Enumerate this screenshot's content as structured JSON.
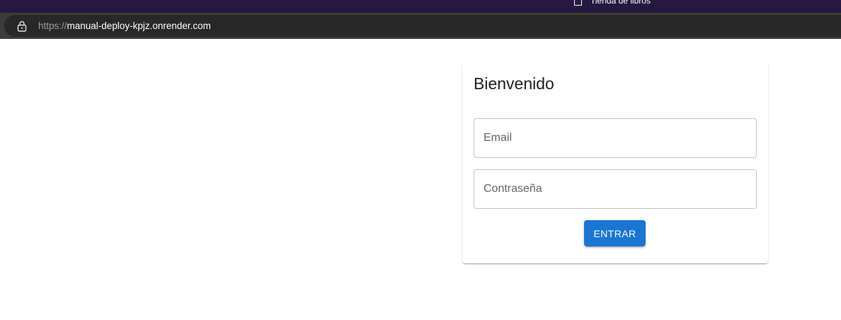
{
  "browser": {
    "bookmark_label": "Tienda de libros",
    "url_scheme": "https://",
    "url_host": "manual-deploy-kpjz.onrender.com"
  },
  "login": {
    "title": "Bienvenido",
    "email_placeholder": "Email",
    "password_placeholder": "Contraseña",
    "submit_label": "ENTRAR",
    "accent_color": "#1976d2"
  },
  "icons": {
    "lock": "lock-icon",
    "bookmark": "bookmark-page-icon"
  }
}
